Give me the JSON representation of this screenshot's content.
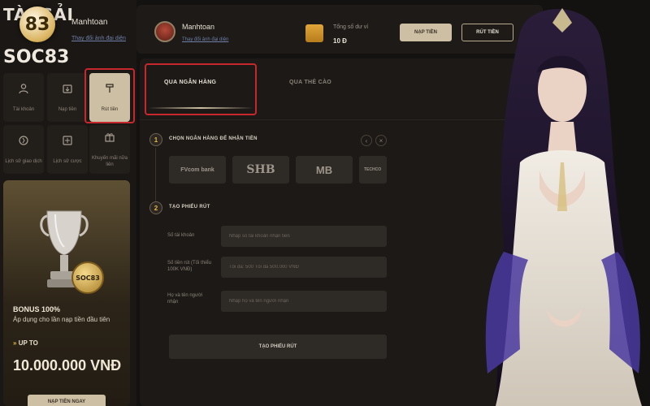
{
  "brand": {
    "title_partial": "TÀ  'GẢI",
    "logo_number": "83",
    "logo_text": "SOC83"
  },
  "mini_user": {
    "name": "Manhtoan",
    "link": "Thay đổi ảnh đại diện"
  },
  "header": {
    "username": "Manhtoan",
    "avatar_link": "Thay đổi ảnh đại diện",
    "balance_label": "Tổng số dư ví",
    "balance_value": "10 Đ",
    "deposit_button": "NẠP TIỀN",
    "withdraw_button": "RÚT TIỀN"
  },
  "nav": {
    "items": [
      {
        "label": "Tài khoản",
        "icon": "user-icon"
      },
      {
        "label": "Nạp tiền",
        "icon": "deposit-icon"
      },
      {
        "label": "Rút tiền",
        "icon": "withdraw-icon",
        "active": true
      },
      {
        "label": "Lịch sử giao dịch",
        "icon": "transaction-history-icon"
      },
      {
        "label": "Lịch sử cược",
        "icon": "bet-history-icon"
      },
      {
        "label": "Khuyến mãi nữa liên",
        "icon": "promotion-icon"
      }
    ]
  },
  "promo": {
    "coin_text": "SOC83",
    "title": "BONUS 100%",
    "description": "Áp dụng cho lần nạp tiền đầu tiên",
    "upto_label": "UP TO",
    "amount": "10.000.000 VNĐ",
    "button": "NẠP TIỀN NGAY"
  },
  "tabs": [
    {
      "label": "QUA NGÂN HÀNG",
      "active": true
    },
    {
      "label": "QUA THẺ CÀO",
      "active": false
    }
  ],
  "step1": {
    "number": "1",
    "title": "CHỌN NGÂN HÀNG ĐỂ NHẬN TIỀN",
    "banks": [
      "FVcom bank",
      "SHB",
      "MB",
      "TECHCO"
    ]
  },
  "step2": {
    "number": "2",
    "title": "TẠO PHIẾU RÚT",
    "fields": [
      {
        "label": "Số tài khoản",
        "placeholder": "Nhập số tài khoản nhận tiền"
      },
      {
        "label": "Số tiền rút (Tối thiểu 100K VNĐ)",
        "placeholder": "Tối đa: 500 Tối đa 500.000 VNĐ"
      },
      {
        "label": "Họ và tên người nhận",
        "placeholder": "Nhập họ và tên người nhận"
      }
    ],
    "submit_button": "TẠO PHIẾU RÚT"
  },
  "colors": {
    "accent_gold": "#cdbfa3",
    "highlight_red": "#c6282e",
    "step_gold": "#e6b844",
    "panel_bg": "#1c1916"
  }
}
